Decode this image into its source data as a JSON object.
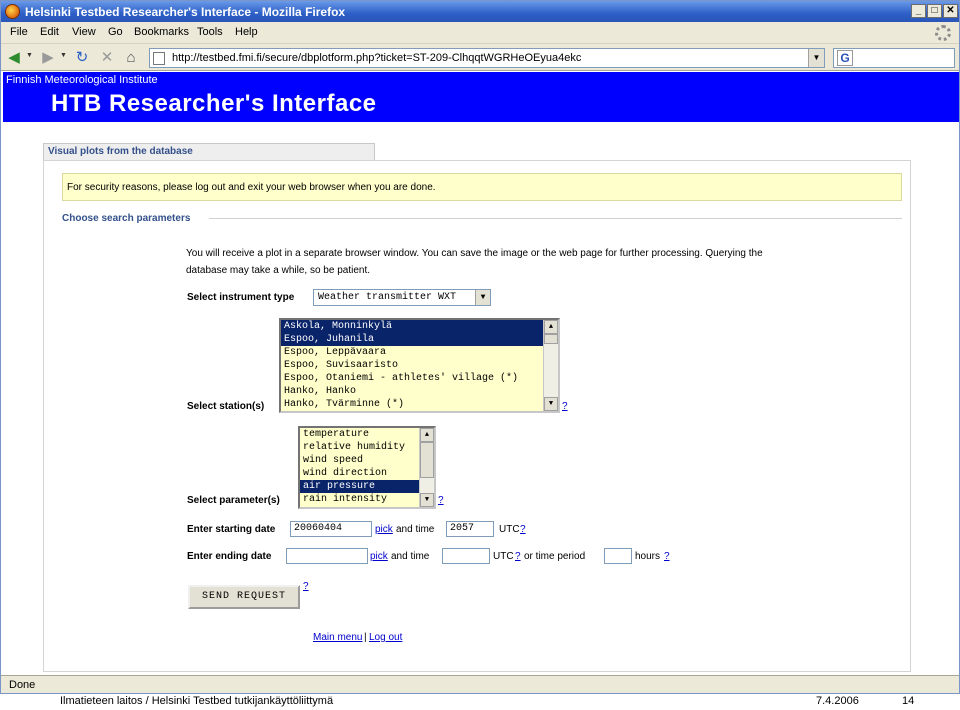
{
  "window": {
    "title": "Helsinki Testbed Researcher's Interface - Mozilla Firefox",
    "buttons": {
      "minimize": "_",
      "maximize": "□",
      "close": "✕"
    }
  },
  "menubar": {
    "items": [
      "File",
      "Edit",
      "View",
      "Go",
      "Bookmarks",
      "Tools",
      "Help"
    ]
  },
  "navbar": {
    "back": "◀",
    "forward": "▶",
    "reload": "↻",
    "stop": "✕",
    "home": "⌂",
    "url": "http://testbed.fmi.fi/secure/dbplotform.php?ticket=ST-209-ClhqqtWGRHeOEyua4ekc",
    "search_engine_icon": "G"
  },
  "header": {
    "institute": "Finnish Meteorological Institute",
    "app_title": "HTB Researcher's Interface"
  },
  "section_tab": "Visual plots from the database",
  "notice": "For security reasons, please log out and exit your web browser when you are done.",
  "fieldset_legend": "Choose search parameters",
  "intro": "You will receive a plot in a separate browser window. You can save the image or the web page for further processing. Querying the database may take a while, so be patient.",
  "form": {
    "instrument_label": "Select instrument type",
    "instrument_value": "Weather transmitter WXT",
    "stations_label": "Select station(s)",
    "stations": [
      {
        "label": "Askola, Monninkylä",
        "selected": true
      },
      {
        "label": "Espoo, Juhanila",
        "selected": true
      },
      {
        "label": "Espoo, Leppävaara",
        "selected": false
      },
      {
        "label": "Espoo, Suvisaaristo",
        "selected": false
      },
      {
        "label": "Espoo, Otaniemi - athletes' village (*)",
        "selected": false
      },
      {
        "label": "Hanko, Hanko",
        "selected": false
      },
      {
        "label": "Hanko, Tvärminne (*)",
        "selected": false
      }
    ],
    "params_label": "Select parameter(s)",
    "params": [
      {
        "label": "temperature",
        "selected": false
      },
      {
        "label": "relative humidity",
        "selected": false
      },
      {
        "label": "wind speed",
        "selected": false
      },
      {
        "label": "wind direction",
        "selected": false
      },
      {
        "label": "air pressure",
        "selected": true
      },
      {
        "label": "rain intensity",
        "selected": false
      }
    ],
    "help": "?",
    "start_label": "Enter starting date",
    "start_date": "20060404",
    "pick": "pick",
    "and_time": "and time",
    "start_time": "2057",
    "utc": "UTC",
    "end_label": "Enter ending date",
    "or_time_period": "or time period",
    "hours": "hours",
    "send_button": "SEND REQUEST"
  },
  "links": {
    "main_menu": "Main menu",
    "separator": "|",
    "log_out": "Log out"
  },
  "status": "Done",
  "footer": {
    "left": "Ilmatieteen laitos / Helsinki Testbed tutkijankäyttöliittymä",
    "date": "7.4.2006",
    "page": "14"
  }
}
